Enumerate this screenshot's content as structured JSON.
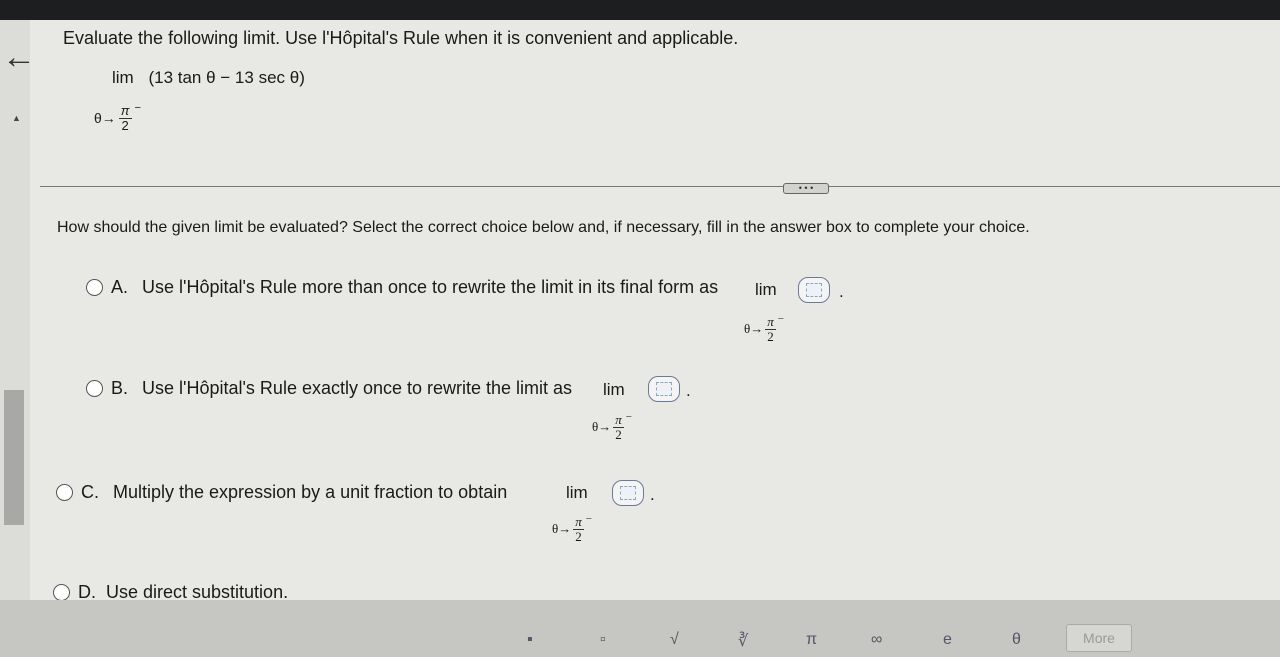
{
  "problem": {
    "prompt": "Evaluate the following limit. Use l'Hôpital's Rule when it is convenient and applicable.",
    "lim_label": "lim",
    "expression": "(13 tan θ − 13 sec θ)",
    "approach_var": "θ→",
    "approach_num": "π",
    "approach_den": "2",
    "approach_side": "−"
  },
  "question": "How should the given limit be evaluated? Select the correct choice below and, if necessary, fill in the answer box to complete your choice.",
  "choices": [
    {
      "letter": "A.",
      "text": "Use l'Hôpital's Rule more than once to rewrite the limit in its final form as",
      "lim": "lim",
      "suffix": "."
    },
    {
      "letter": "B.",
      "text": "Use l'Hôpital's Rule exactly once to rewrite the limit as",
      "lim": "lim",
      "suffix": "."
    },
    {
      "letter": "C.",
      "text": "Multiply the expression by a unit fraction to obtain",
      "lim": "lim",
      "suffix": "."
    },
    {
      "letter": "D.",
      "text": "Use direct substitution.",
      "suffix": ""
    }
  ],
  "toolbar": {
    "items": [
      "▪",
      "▫",
      "√",
      "∛",
      "π",
      "∞",
      "e",
      "θ"
    ],
    "more_label": "More"
  },
  "expand_label": "• • •"
}
